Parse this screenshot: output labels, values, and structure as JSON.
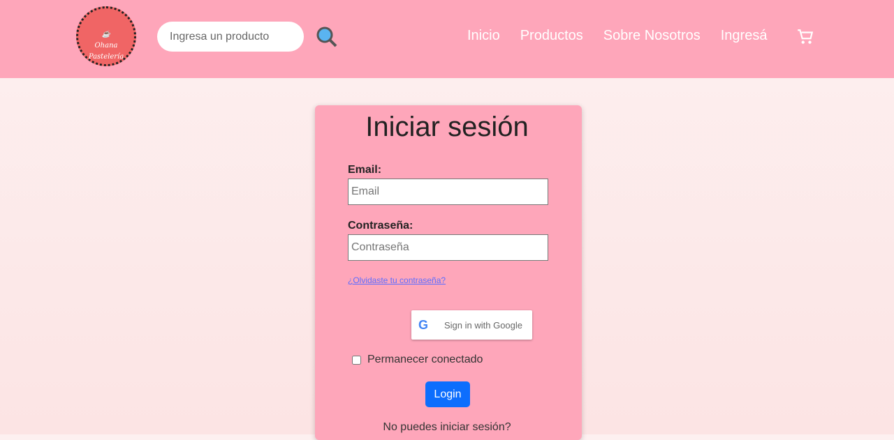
{
  "header": {
    "logo_text": "Ohana Pastelería",
    "search_placeholder": "Ingresa un producto",
    "nav": [
      "Inicio",
      "Productos",
      "Sobre Nosotros",
      "Ingresá"
    ]
  },
  "login": {
    "title": "Iniciar sesión",
    "email_label": "Email:",
    "email_placeholder": "Email",
    "password_label": "Contraseña:",
    "password_placeholder": "Contraseña",
    "forgot": "¿Olvidaste tu contraseña?",
    "google": "Sign in with Google",
    "remember": "Permanecer conectado",
    "login_button": "Login",
    "cant_login": "No puedes iniciar sesión?"
  },
  "colors": {
    "header": "#fea6ba",
    "primary": "#0d6efd",
    "logo": "#f06565"
  }
}
